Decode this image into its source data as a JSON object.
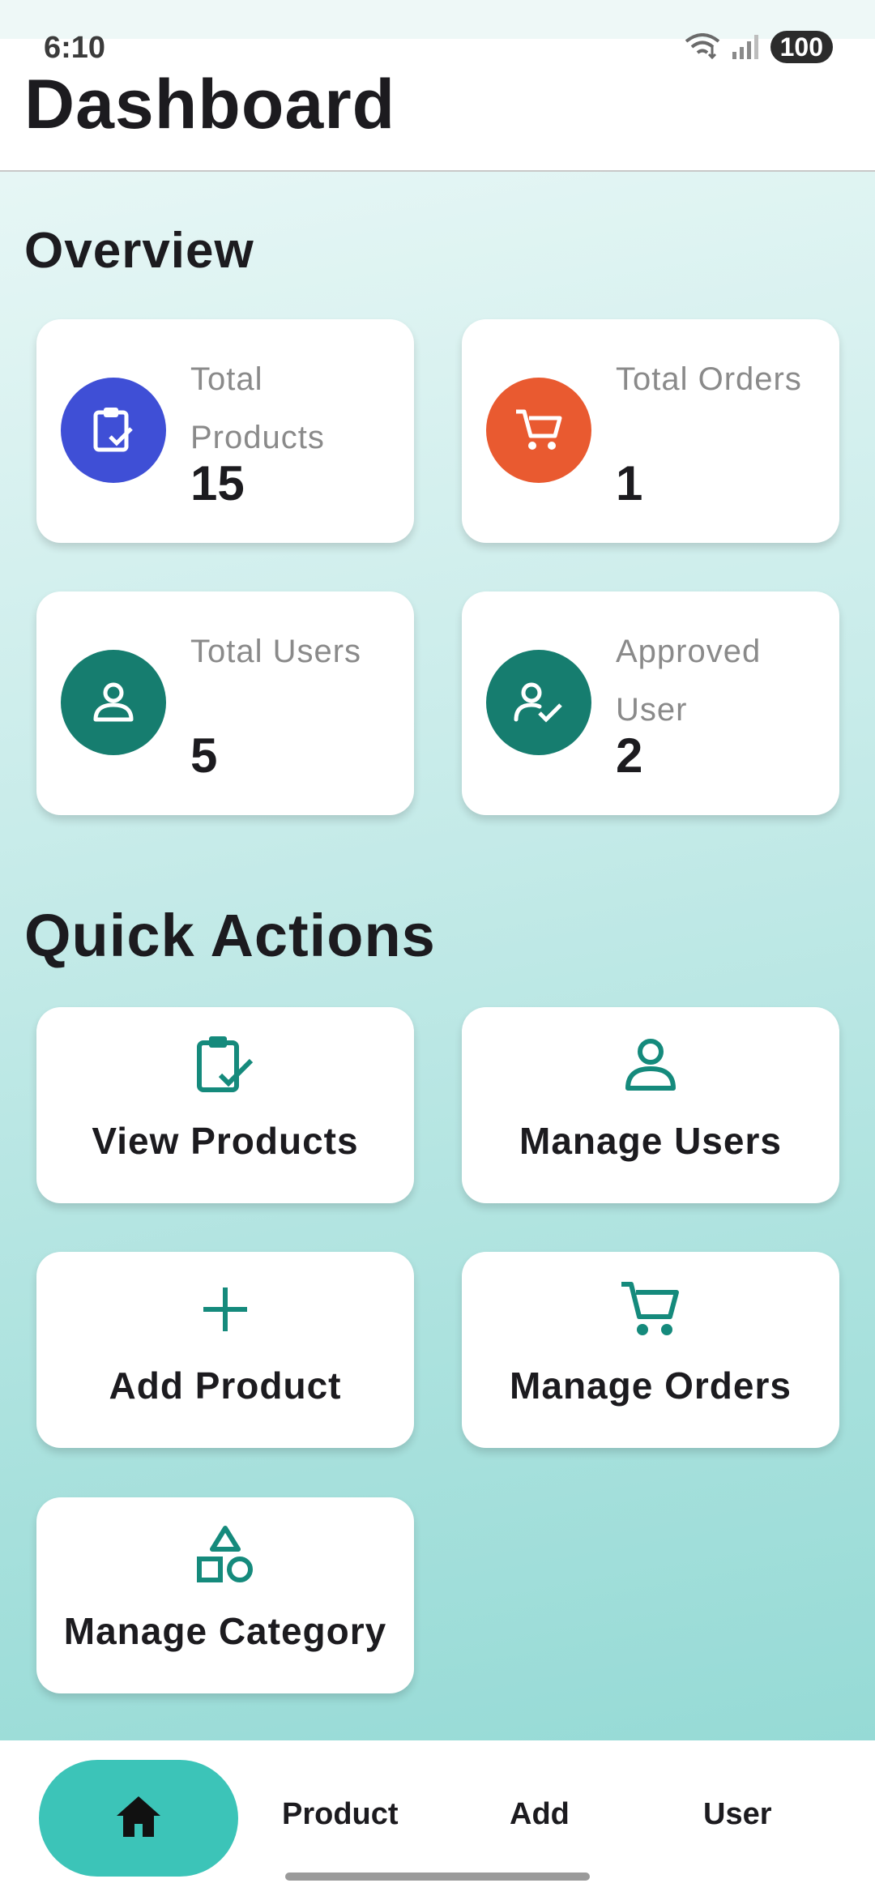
{
  "status_bar": {
    "time": "6:10",
    "battery": "100",
    "icons": [
      "wifi-icon",
      "signal-icon",
      "battery-icon"
    ]
  },
  "header": {
    "title": "Dashboard"
  },
  "overview": {
    "title": "Overview",
    "cards": [
      {
        "label": "Total Products",
        "value": "15",
        "icon": "clipboard-check-icon",
        "color": "#3f4fd6"
      },
      {
        "label": "Total Orders",
        "value": "1",
        "icon": "cart-icon",
        "color": "#e95a30"
      },
      {
        "label": "Total Users",
        "value": "5",
        "icon": "user-icon",
        "color": "#167d6f"
      },
      {
        "label": "Approved User",
        "value": "2",
        "icon": "user-check-icon",
        "color": "#167d6f"
      }
    ]
  },
  "quick_actions": {
    "title": "Quick Actions",
    "items": [
      {
        "label": "View Products",
        "icon": "clipboard-check-icon"
      },
      {
        "label": "Manage Users",
        "icon": "user-icon"
      },
      {
        "label": "Add Product",
        "icon": "plus-icon"
      },
      {
        "label": "Manage Orders",
        "icon": "cart-icon"
      },
      {
        "label": "Manage Category",
        "icon": "shapes-icon"
      }
    ]
  },
  "bottom_nav": {
    "items": [
      {
        "label": "",
        "icon": "home-icon",
        "active": true
      },
      {
        "label": "Product"
      },
      {
        "label": "Add"
      },
      {
        "label": "User"
      }
    ]
  },
  "colors": {
    "accent": "#158a7c",
    "nav_active": "#3cc4b8",
    "background_gradient": [
      "#eef9f8",
      "#8fd8d3"
    ]
  }
}
